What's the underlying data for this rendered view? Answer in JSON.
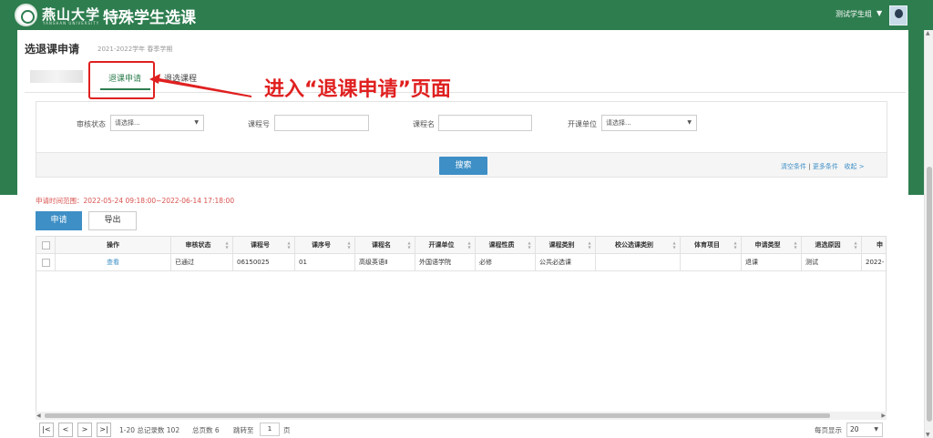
{
  "header": {
    "university_name": "燕山大学",
    "university_sub": "YANSHAN UNIVERSITY",
    "system_title": "特殊学生选课",
    "user_name": "测试学生组",
    "user_caret": "▼"
  },
  "page": {
    "title": "选退课申请",
    "term": "2021-2022学年 春季学期"
  },
  "tabs": [
    {
      "label": "退课申请",
      "active": true
    },
    {
      "label": "退选课程",
      "active": false
    }
  ],
  "annotation": {
    "text": "进入“退课申请”页面",
    "color": "#e02020"
  },
  "filters": {
    "status_label": "审核状态",
    "status_value": "请选择...",
    "course_no_label": "课程号",
    "course_no_value": "",
    "course_name_label": "课程名",
    "course_name_value": "",
    "dept_label": "开课单位",
    "dept_value": "请选择...",
    "search_button": "搜索",
    "clear_link": "清空条件",
    "sep": "|",
    "more_link": "更多条件",
    "collapse_link": "收起 >"
  },
  "time_range": "申请时间范围：2022-05-24 09:18:00~2022-06-14 17:18:00",
  "actions": {
    "apply": "申请",
    "export": "导出"
  },
  "table": {
    "columns": [
      "",
      "操作",
      "审核状态",
      "课程号",
      "课序号",
      "课程名",
      "开课单位",
      "课程性质",
      "课程类别",
      "校公选课类别",
      "体育项目",
      "申请类型",
      "退选原因",
      "申"
    ],
    "rows": [
      [
        "",
        "查看",
        "已通过",
        "06150025",
        "01",
        "高级英语Ⅱ",
        "外国语学院",
        "必修",
        "公共必选课",
        "",
        "",
        "退课",
        "测试",
        "2022-"
      ]
    ]
  },
  "pager": {
    "first": "|<",
    "prev": "<",
    "next": ">",
    "last": ">|",
    "summary": "1-20 总记录数 102",
    "total_pages": "总页数 6",
    "jump_label": "跳转至",
    "jump_value": "1",
    "page_unit": "页",
    "per_page_label": "每页显示",
    "per_page_value": "20",
    "caret": "▼"
  },
  "colors": {
    "brand_green": "#2e7d4f",
    "accent_blue": "#3e8fc6",
    "time_red": "#d9534f"
  }
}
